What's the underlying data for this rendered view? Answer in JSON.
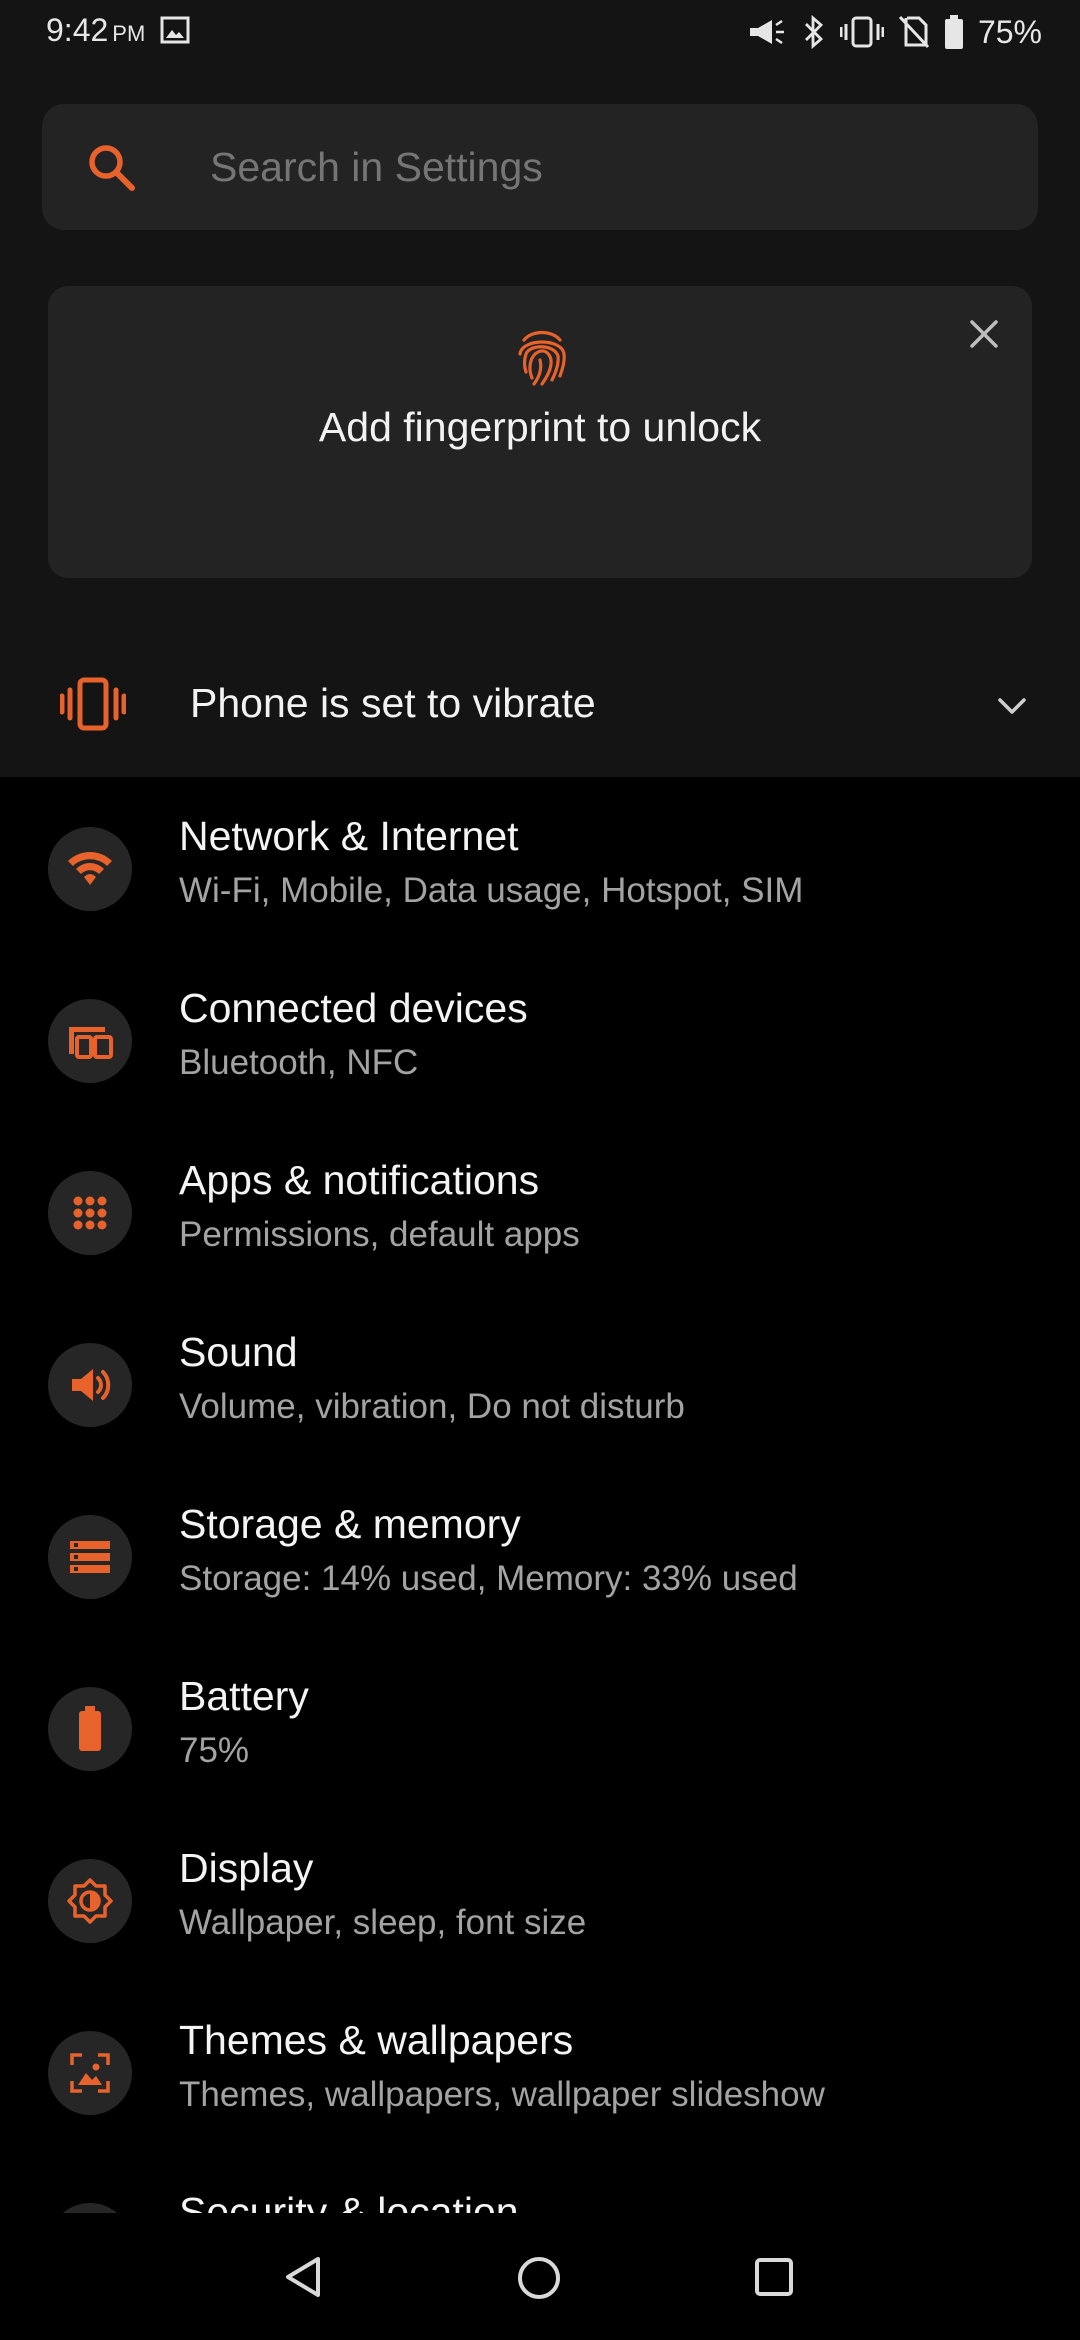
{
  "status_bar": {
    "time": "9:42",
    "ampm": "PM",
    "battery_percent": "75%",
    "icons": [
      "gallery-icon",
      "megaphone-icon",
      "bluetooth-icon",
      "vibrate-icon",
      "no-sim-icon",
      "battery-icon"
    ]
  },
  "search": {
    "placeholder": "Search in Settings"
  },
  "fingerprint_card": {
    "text": "Add fingerprint to unlock"
  },
  "vibrate_banner": {
    "text": "Phone is set to vibrate"
  },
  "colors": {
    "accent": "#e8622c",
    "background": "#000000",
    "panel": "#141414",
    "card": "#232323"
  },
  "settings": [
    {
      "title": "Network & Internet",
      "summary": "Wi-Fi, Mobile, Data usage, Hotspot, SIM",
      "icon": "wifi-icon"
    },
    {
      "title": "Connected devices",
      "summary": "Bluetooth, NFC",
      "icon": "devices-icon"
    },
    {
      "title": "Apps & notifications",
      "summary": "Permissions, default apps",
      "icon": "apps-grid-icon"
    },
    {
      "title": "Sound",
      "summary": "Volume, vibration, Do not disturb",
      "icon": "speaker-icon"
    },
    {
      "title": "Storage & memory",
      "summary": "Storage: 14% used, Memory: 33% used",
      "icon": "storage-icon"
    },
    {
      "title": "Battery",
      "summary": "75%",
      "icon": "battery-icon"
    },
    {
      "title": "Display",
      "summary": "Wallpaper, sleep, font size",
      "icon": "brightness-icon"
    },
    {
      "title": "Themes & wallpapers",
      "summary": "Themes, wallpapers, wallpaper slideshow",
      "icon": "wallpaper-icon"
    },
    {
      "title": "Security & location",
      "summary": "",
      "icon": "lock-icon"
    }
  ]
}
